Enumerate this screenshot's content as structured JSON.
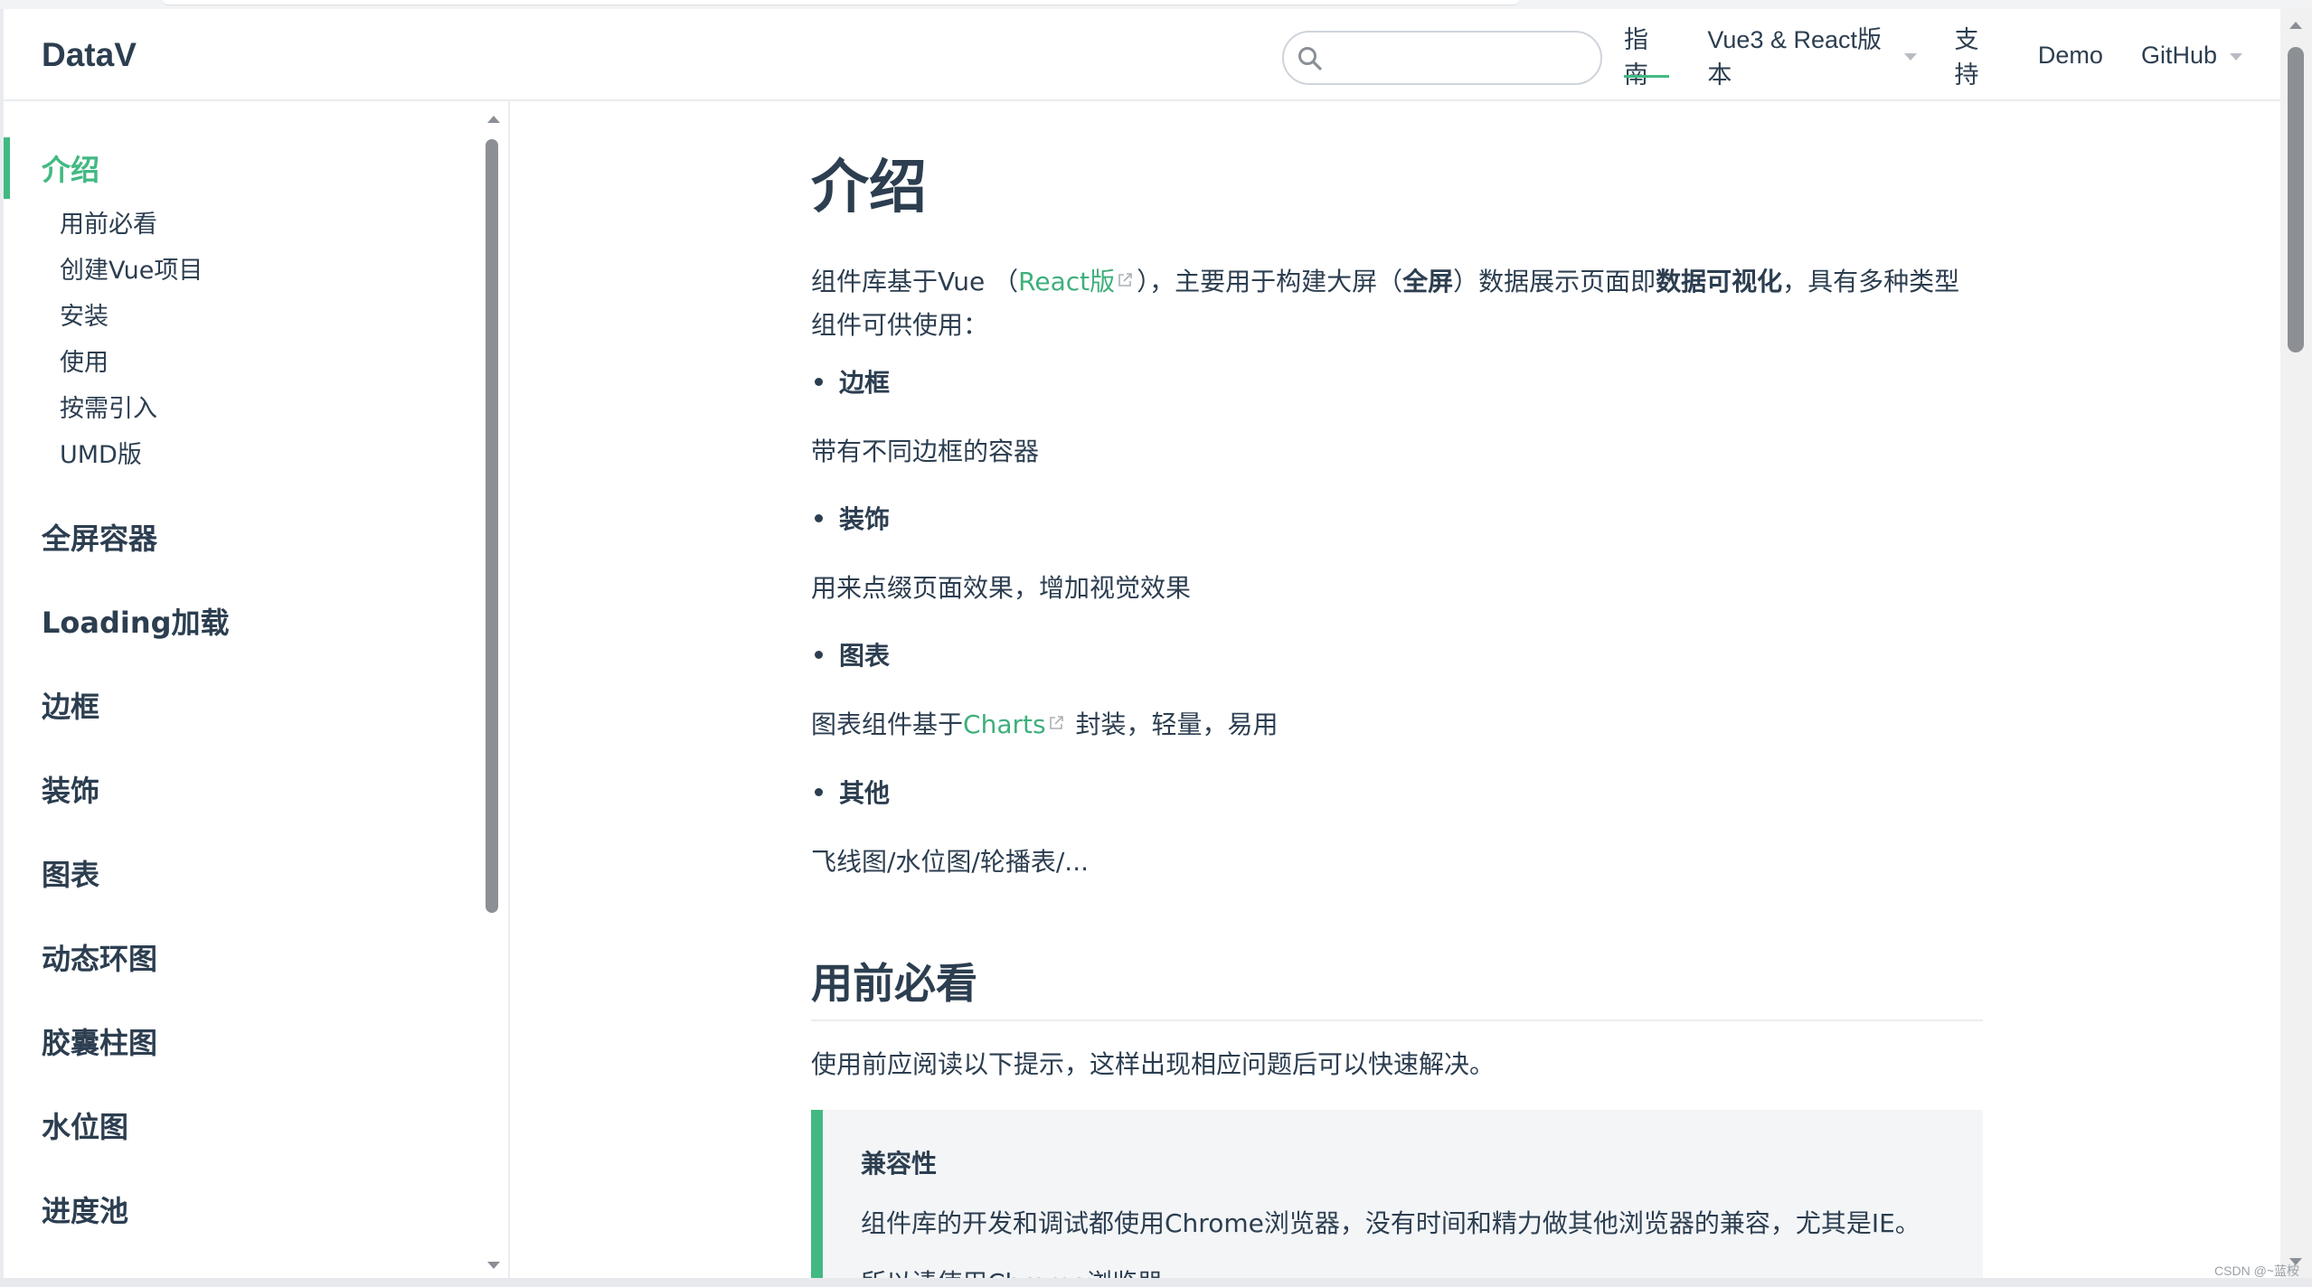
{
  "navbar": {
    "logo": "DataV",
    "search": {
      "placeholder": "",
      "value": ""
    },
    "items": [
      {
        "label": "指南",
        "active": true,
        "dropdown": false
      },
      {
        "label": "Vue3 & React版本",
        "active": false,
        "dropdown": true
      },
      {
        "label": "支持",
        "active": false,
        "dropdown": false
      },
      {
        "label": "Demo",
        "active": false,
        "dropdown": false
      },
      {
        "label": "GitHub",
        "active": false,
        "dropdown": true
      }
    ]
  },
  "sidebar": {
    "active_group": {
      "title": "介绍",
      "items": [
        "用前必看",
        "创建Vue项目",
        "安装",
        "使用",
        "按需引入",
        "UMD版"
      ]
    },
    "groups": [
      "全屏容器",
      "Loading加载",
      "边框",
      "装饰",
      "图表",
      "动态环图",
      "胶囊柱图",
      "水位图",
      "进度池"
    ]
  },
  "content": {
    "title": "介绍",
    "intro": {
      "part1": "组件库基于Vue （",
      "react_link": "React版",
      "part2": "），主要用于构建大屏（",
      "bold1": "全屏",
      "part3": "）数据展示页面即",
      "bold2": "数据可视化",
      "part4": "，具有多种类型",
      "line2": "组件可供使用："
    },
    "sections": [
      {
        "bullet": "边框",
        "desc": "带有不同边框的容器"
      },
      {
        "bullet": "装饰",
        "desc": "用来点缀页面效果，增加视觉效果"
      },
      {
        "bullet": "图表",
        "desc_pre": "图表组件基于",
        "desc_link": "Charts",
        "desc_post": " 封装，轻量，易用"
      },
      {
        "bullet": "其他",
        "desc": "飞线图/水位图/轮播表/..."
      }
    ],
    "h2": "用前必看",
    "h2_desc": "使用前应阅读以下提示，这样出现相应问题后可以快速解决。",
    "tip": {
      "title": "兼容性",
      "body": "组件库的开发和调试都使用Chrome浏览器，没有时间和精力做其他浏览器的兼容，尤其是IE。",
      "more": "所以请使用Chrome浏览器。"
    }
  },
  "watermark": "CSDN @~蓝桉",
  "colors": {
    "accent": "#42b983",
    "link": "#3eaf7c",
    "text": "#2c3e50"
  }
}
